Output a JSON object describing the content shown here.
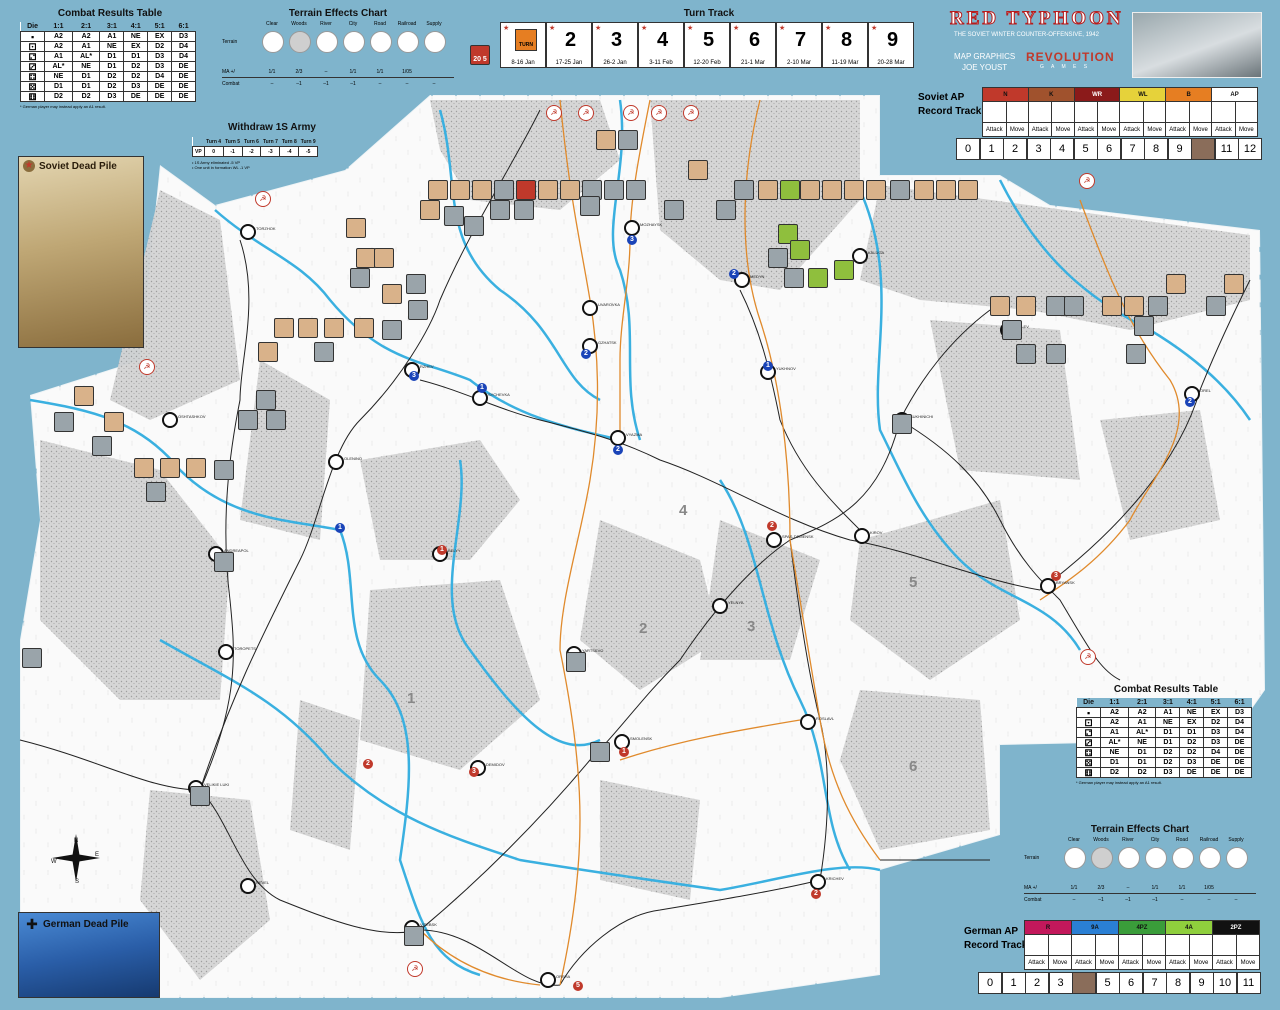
{
  "game": {
    "title": "RED TYPHOON",
    "subtitle": "THE SOVIET WINTER COUNTER-OFFENSIVE, 1942",
    "credits_1": "MAP GRAPHICS",
    "credits_2": "JOE YOUST",
    "publisher_1": "REVOLUTION",
    "publisher_2": "G A M E S"
  },
  "crt": {
    "title": "Combat Results Table",
    "headers": [
      "Die",
      "1:1",
      "2:1",
      "3:1",
      "4:1",
      "5:1",
      "6:1"
    ],
    "rows": [
      [
        "A2",
        "A2",
        "A1",
        "NE",
        "EX",
        "D3"
      ],
      [
        "A2",
        "A1",
        "NE",
        "EX",
        "D2",
        "D4"
      ],
      [
        "A1",
        "AL*",
        "D1",
        "D1",
        "D3",
        "D4"
      ],
      [
        "AL*",
        "NE",
        "D1",
        "D2",
        "D3",
        "DE"
      ],
      [
        "NE",
        "D1",
        "D2",
        "D2",
        "D4",
        "DE"
      ],
      [
        "D1",
        "D1",
        "D2",
        "D3",
        "DE",
        "DE"
      ],
      [
        "D2",
        "D2",
        "D3",
        "DE",
        "DE",
        "DE"
      ]
    ],
    "note": "* German player may instead apply an A1 result."
  },
  "tec": {
    "title": "Terrain Effects Chart",
    "terrain_label": "Terrain",
    "types": [
      "Clear",
      "Woods",
      "River",
      "City",
      "Road",
      "Railroad",
      "Supply"
    ],
    "ma_label": "MA +/",
    "ma": [
      "1/1",
      "2/3",
      "–",
      "1/1",
      "1/1",
      "1/05",
      ""
    ],
    "combat_label": "Combat",
    "combat": [
      "–",
      "–1",
      "–1",
      "–1",
      "–",
      "–",
      "–"
    ]
  },
  "turn_track": {
    "title": "Turn Track",
    "turns": [
      {
        "n": "1",
        "dates": "8-16 Jan",
        "label": "TURN"
      },
      {
        "n": "2",
        "dates": "17-25 Jan"
      },
      {
        "n": "3",
        "dates": "26-2 Jan"
      },
      {
        "n": "4",
        "dates": "3-11 Feb"
      },
      {
        "n": "5",
        "dates": "12-20 Feb"
      },
      {
        "n": "6",
        "dates": "21-1 Mar"
      },
      {
        "n": "7",
        "dates": "2-10 Mar"
      },
      {
        "n": "8",
        "dates": "11-19 Mar"
      },
      {
        "n": "9",
        "dates": "20-28 Mar"
      }
    ]
  },
  "withdraw": {
    "title": "Withdraw 1S Army",
    "turns": [
      "Turn 4",
      "Turn 5",
      "Turn 6",
      "Turn 7",
      "Turn 8",
      "Turn 9"
    ],
    "vp_label": "VP",
    "vp": [
      "0",
      "-1",
      "-2",
      "-3",
      "-4",
      "-5"
    ],
    "note1": "• 1S Army eliminated -5 VP",
    "note2": "• One unit in formation WL -1 VP"
  },
  "soviet_ap": {
    "title_1": "Soviet AP",
    "title_2": "Record Track",
    "cols": [
      {
        "label": "N",
        "color": "#c0392b"
      },
      {
        "label": "K",
        "color": "#a0522d"
      },
      {
        "label": "WR",
        "color": "#8b1a1a"
      },
      {
        "label": "WL",
        "color": "#e6d23a"
      },
      {
        "label": "B",
        "color": "#e67e22"
      },
      {
        "label": "AP",
        "color": "#ffffff"
      }
    ],
    "attack": "Attack",
    "move": "Move",
    "track": [
      "0",
      "1",
      "2",
      "3",
      "4",
      "5",
      "6",
      "7",
      "8",
      "9",
      "",
      "11",
      "12"
    ]
  },
  "german_ap": {
    "title_1": "German AP",
    "title_2": "Record Track",
    "cols": [
      {
        "label": "R",
        "color": "#c2185b"
      },
      {
        "label": "9A",
        "color": "#2a7fd4"
      },
      {
        "label": "4PZ",
        "color": "#3a9d3a"
      },
      {
        "label": "4A",
        "color": "#8fcf3d"
      },
      {
        "label": "2PZ",
        "color": "#111111"
      }
    ],
    "attack": "Attack",
    "move": "Move",
    "track": [
      "0",
      "1",
      "2",
      "3",
      "",
      "5",
      "6",
      "7",
      "8",
      "9",
      "10",
      "11"
    ]
  },
  "dead_piles": {
    "soviet": "Soviet Dead Pile",
    "german": "German Dead Pile"
  },
  "cities": [
    "TORZHOK",
    "RZHEV",
    "SYCHEVKA",
    "VYAZMA",
    "GZHATSK",
    "UVAROVKA",
    "MOZHAYSK",
    "MEDYN",
    "KALUGA",
    "YUKHNOV",
    "SUKHINICHI",
    "BELEV",
    "OREL",
    "OSHTASHKOV",
    "OLENINO",
    "BELYY",
    "SPAS-DEMENSK",
    "KIROV",
    "BRYANSK",
    "ANDREAPOL",
    "TOROPETS",
    "YARTSEVO",
    "YELNYA",
    "ROSLAVL",
    "VELIKIE LUKI",
    "DEMIDOV",
    "SMOLENSK",
    "NEVEL",
    "KRICHEV",
    "VITEBSK",
    "ORSHA"
  ],
  "zones": [
    "1",
    "2",
    "3",
    "4",
    "5",
    "6"
  ]
}
